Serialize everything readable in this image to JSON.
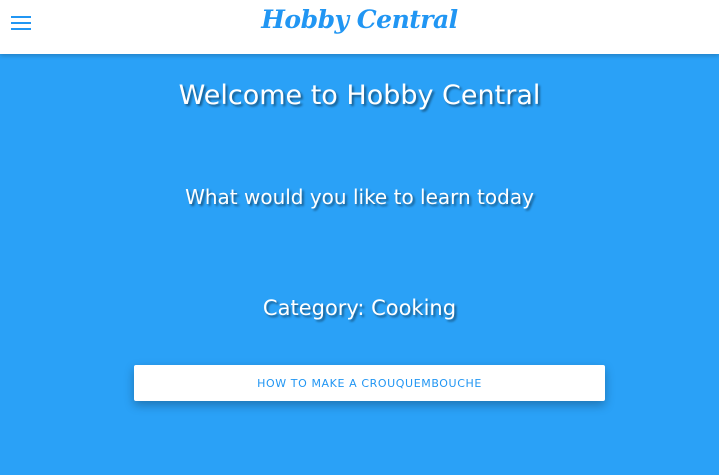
{
  "header": {
    "menu_icon": "hamburger-menu-icon",
    "brand": "Hobby Central",
    "brand_color": "#2196f3"
  },
  "main": {
    "background_color": "#2aa1f7",
    "welcome": "Welcome to Hobby Central",
    "prompt": "What would you like to learn today",
    "category_label": "Category: Cooking",
    "lessons": [
      {
        "label": "HOW TO MAKE A CROUQUEMBOUCHE"
      }
    ]
  }
}
